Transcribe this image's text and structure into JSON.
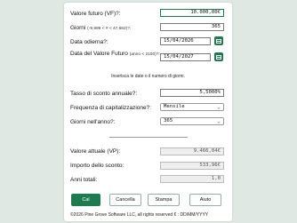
{
  "fields": {
    "future_value": {
      "label": "Valore futuro (VF)?:",
      "value": "10.000,00€"
    },
    "days": {
      "label": "Giorni",
      "hint": "(-9,999 < # < 47,682)?:",
      "value": "365"
    },
    "today": {
      "label": "Data odierna?:",
      "value": "15/04/2026"
    },
    "future_date": {
      "label": "Data del Valore Futuro",
      "hint": "(anno < 2100)?:",
      "value": "15/04/2027"
    },
    "message": "Inserisca le date o il numero di giorni.",
    "discount_rate": {
      "label": "Tasso di sconto annuale?:",
      "value": "5,5000%"
    },
    "frequency": {
      "label": "Frequenza di capitalizzazione?:",
      "value": "Mensile"
    },
    "days_year": {
      "label": "Giorni nell'anno?:",
      "value": "365"
    },
    "present_value": {
      "label": "Valore attuale (VP):",
      "value": "9.466,04€"
    },
    "discount_amount": {
      "label": "Importo dello sconto:",
      "value": "533,96€"
    },
    "total_years": {
      "label": "Anni totali:",
      "value": "1,0"
    }
  },
  "buttons": {
    "calc": "Cal",
    "cancel": "Cancella",
    "print": "Stampa",
    "help": "Aiuto"
  },
  "footer": "©2026 Pine Grove Software LLC, all rights reserved  € : DD/MM/YYYY",
  "colors": {
    "accent": "#1e7a4f",
    "background": "#dfe8e2"
  }
}
